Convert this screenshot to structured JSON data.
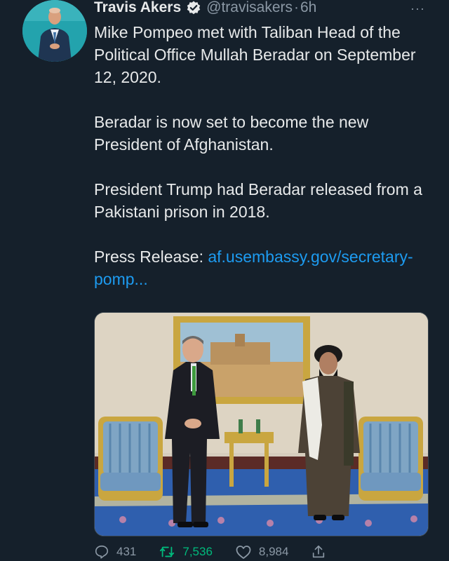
{
  "author": {
    "name": "Travis Akers",
    "handle": "@travisakers",
    "separator": "·",
    "time": "6h",
    "verified": true
  },
  "more_label": "···",
  "body": {
    "p1": "Mike Pompeo met with Taliban Head of the Political Office Mullah Beradar on September 12, 2020.",
    "p2": "Beradar is now set to become the new President of Afghanistan.",
    "p3": "President Trump had Beradar released from a Pakistani prison in 2018.",
    "p4_prefix": "Press Release: ",
    "p4_link": "af.usembassy.gov/secretary-pomp..."
  },
  "actions": {
    "replies": "431",
    "retweets": "7,536",
    "likes": "8,984"
  },
  "icons": [
    "verified-badge-icon",
    "more-icon",
    "reply-icon",
    "retweet-icon",
    "like-icon",
    "share-icon"
  ],
  "colors": {
    "background": "#15202b",
    "text": "#e7e9ea",
    "muted": "#8b98a5",
    "link": "#1d9bf0",
    "retweet": "#00ba7c"
  }
}
